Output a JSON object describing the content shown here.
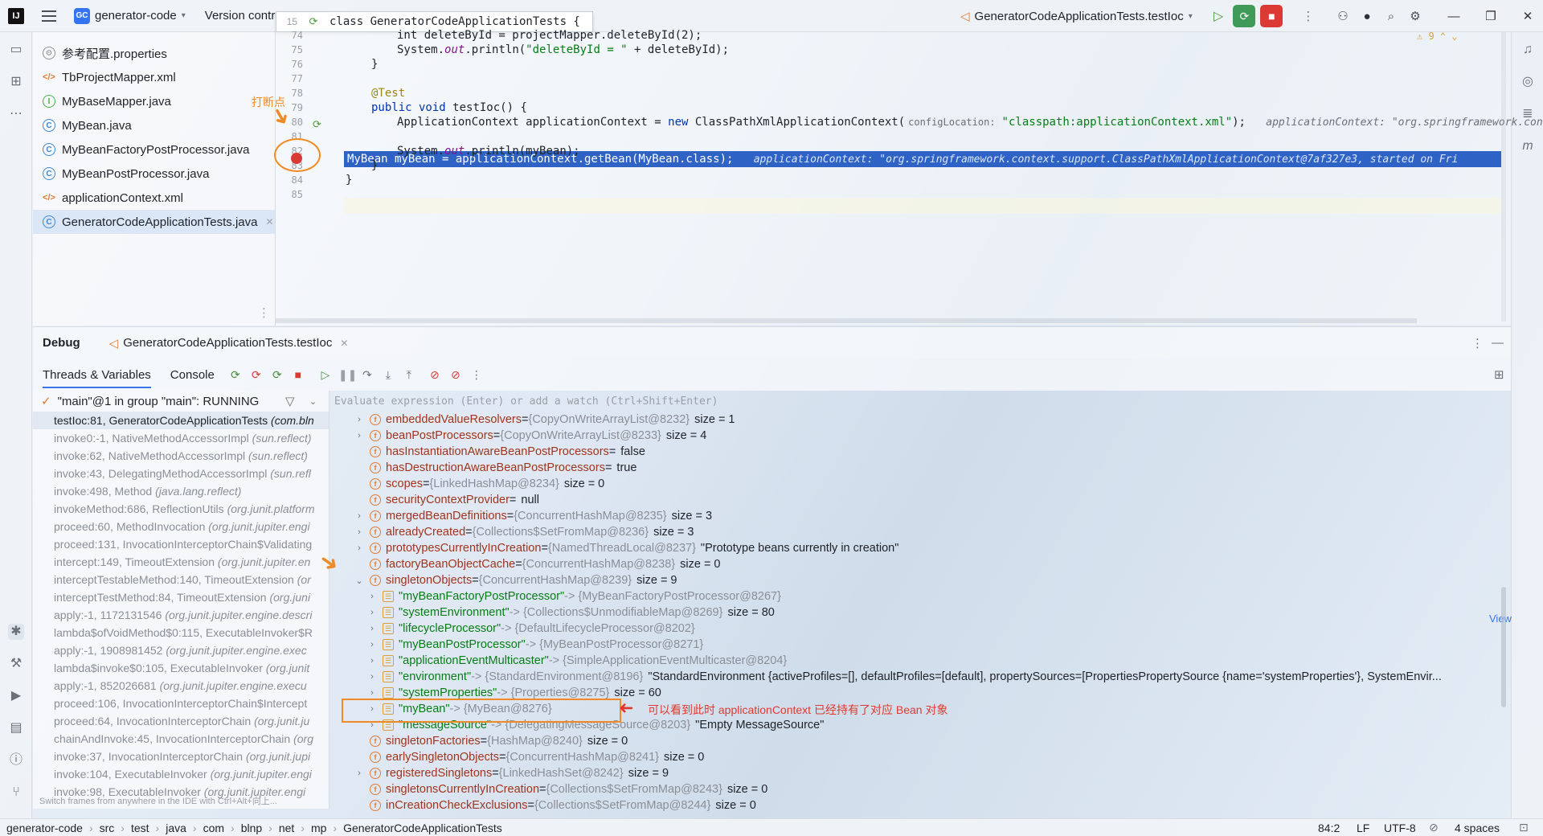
{
  "titlebar": {
    "project_badge": "GC",
    "project_name": "generator-code",
    "version_control": "Version contro",
    "popup_line": "15",
    "popup_code": "class GeneratorCodeApplicationTests {",
    "run_config": "GeneratorCodeApplicationTests.testIoc",
    "warnings": "9"
  },
  "project_tree": [
    {
      "icon": "props",
      "label": "参考配置.properties"
    },
    {
      "icon": "xml",
      "label": "TbProjectMapper.xml"
    },
    {
      "icon": "iface",
      "label": "MyBaseMapper.java"
    },
    {
      "icon": "cls",
      "label": "MyBean.java"
    },
    {
      "icon": "cls",
      "label": "MyBeanFactoryPostProcessor.java"
    },
    {
      "icon": "cls",
      "label": "MyBeanPostProcessor.java"
    },
    {
      "icon": "xml",
      "label": "applicationContext.xml"
    },
    {
      "icon": "cls",
      "label": "GeneratorCodeApplicationTests.java"
    }
  ],
  "editor": {
    "line_numbers": [
      "74",
      "75",
      "76",
      "77",
      "78",
      "79",
      "80",
      "81",
      "82",
      "83",
      "84",
      "85"
    ],
    "breakpoint_label": "打断点",
    "l74": "int deleteById = projectMapper.deleteById(2);",
    "l75_a": "System.",
    "l75_b": "out",
    "l75_c": ".println(",
    "l75_d": "\"deleteById = \"",
    "l75_e": " + deleteById);",
    "l76": "}",
    "l78": "@Test",
    "l79_kw": "public void ",
    "l79_rest": "testIoc() {",
    "l80_a": "ApplicationContext applicationContext = ",
    "l80_kw": "new ",
    "l80_b": "ClassPathXmlApplicationContext(",
    "l80_hint": "configLocation:",
    "l80_str": "\"classpath:applicationContext.xml\"",
    "l80_end": ");",
    "l80_inline": "applicationContext: \"org.springframework.contex",
    "l81": "MyBean myBean = applicationContext.getBean(MyBean.class);",
    "l81_inline": "applicationContext: \"org.springframework.context.support.ClassPathXmlApplicationContext@7af327e3, started on Fri",
    "l82_a": "System.",
    "l82_b": "out",
    "l82_c": ".println(myBean);",
    "l83": "}",
    "l84": "}"
  },
  "debug": {
    "title": "Debug",
    "session_tab": "GeneratorCodeApplicationTests.testIoc",
    "tab_threads": "Threads & Variables",
    "tab_console": "Console",
    "thread": "\"main\"@1 in group \"main\": RUNNING",
    "eval_placeholder": "Evaluate expression (Enter) or add a watch (Ctrl+Shift+Enter)",
    "frames_tip": "Switch frames from anywhere in the IDE with Ctrl+Alt+向上...",
    "frames": [
      {
        "m": "testIoc:81, GeneratorCodeApplicationTests",
        "p": "(com.bln"
      },
      {
        "m": "invoke0:-1, NativeMethodAccessorImpl",
        "p": "(sun.reflect)"
      },
      {
        "m": "invoke:62, NativeMethodAccessorImpl",
        "p": "(sun.reflect)"
      },
      {
        "m": "invoke:43, DelegatingMethodAccessorImpl",
        "p": "(sun.refl"
      },
      {
        "m": "invoke:498, Method",
        "p": "(java.lang.reflect)"
      },
      {
        "m": "invokeMethod:686, ReflectionUtils",
        "p": "(org.junit.platform"
      },
      {
        "m": "proceed:60, MethodInvocation",
        "p": "(org.junit.jupiter.engi"
      },
      {
        "m": "proceed:131, InvocationInterceptorChain$Validating",
        "p": ""
      },
      {
        "m": "intercept:149, TimeoutExtension",
        "p": "(org.junit.jupiter.en"
      },
      {
        "m": "interceptTestableMethod:140, TimeoutExtension",
        "p": "(or"
      },
      {
        "m": "interceptTestMethod:84, TimeoutExtension",
        "p": "(org.juni"
      },
      {
        "m": "apply:-1, 1172131546",
        "p": "(org.junit.jupiter.engine.descri"
      },
      {
        "m": "lambda$ofVoidMethod$0:115, ExecutableInvoker$R",
        "p": ""
      },
      {
        "m": "apply:-1, 1908981452",
        "p": "(org.junit.jupiter.engine.exec"
      },
      {
        "m": "lambda$invoke$0:105, ExecutableInvoker",
        "p": "(org.junit"
      },
      {
        "m": "apply:-1, 852026681",
        "p": "(org.junit.jupiter.engine.execu"
      },
      {
        "m": "proceed:106, InvocationInterceptorChain$Intercept",
        "p": ""
      },
      {
        "m": "proceed:64, InvocationInterceptorChain",
        "p": "(org.junit.ju"
      },
      {
        "m": "chainAndInvoke:45, InvocationInterceptorChain",
        "p": "(org"
      },
      {
        "m": "invoke:37, InvocationInterceptorChain",
        "p": "(org.junit.jupi"
      },
      {
        "m": "invoke:104, ExecutableInvoker",
        "p": "(org.junit.jupiter.engi"
      },
      {
        "m": "invoke:98, ExecutableInvoker",
        "p": "(org.junit.jupiter.engi"
      }
    ],
    "variables": [
      {
        "d": 0,
        "c": "›",
        "i": "f",
        "n": "embeddedValueResolvers",
        "m": "{CopyOnWriteArrayList@8232}",
        "v": "size = 1"
      },
      {
        "d": 0,
        "c": "›",
        "i": "f",
        "n": "beanPostProcessors",
        "m": "{CopyOnWriteArrayList@8233}",
        "v": "size = 4"
      },
      {
        "d": 0,
        "c": "",
        "i": "f",
        "n": "hasInstantiationAwareBeanPostProcessors",
        "m": "",
        "v": "false"
      },
      {
        "d": 0,
        "c": "",
        "i": "f",
        "n": "hasDestructionAwareBeanPostProcessors",
        "m": "",
        "v": "true"
      },
      {
        "d": 0,
        "c": "",
        "i": "f",
        "n": "scopes",
        "m": "{LinkedHashMap@8234}",
        "v": "size = 0"
      },
      {
        "d": 0,
        "c": "",
        "i": "f",
        "n": "securityContextProvider",
        "m": "",
        "v": "null"
      },
      {
        "d": 0,
        "c": "›",
        "i": "f",
        "n": "mergedBeanDefinitions",
        "m": "{ConcurrentHashMap@8235}",
        "v": "size = 3"
      },
      {
        "d": 0,
        "c": "›",
        "i": "f",
        "n": "alreadyCreated",
        "m": "{Collections$SetFromMap@8236}",
        "v": "size = 3"
      },
      {
        "d": 0,
        "c": "›",
        "i": "f",
        "n": "prototypesCurrentlyInCreation",
        "m": "{NamedThreadLocal@8237}",
        "v": "\"Prototype beans currently in creation\""
      },
      {
        "d": 0,
        "c": "",
        "i": "f",
        "n": "factoryBeanObjectCache",
        "m": "{ConcurrentHashMap@8238}",
        "v": "size = 0"
      },
      {
        "d": 0,
        "c": "⌄",
        "i": "f",
        "n": "singletonObjects",
        "m": "{ConcurrentHashMap@8239}",
        "v": "size = 9"
      },
      {
        "d": 1,
        "c": "›",
        "i": "map",
        "n": "\"myBeanFactoryPostProcessor\"",
        "m": "-> {MyBeanFactoryPostProcessor@8267}",
        "v": ""
      },
      {
        "d": 1,
        "c": "›",
        "i": "map",
        "n": "\"systemEnvironment\"",
        "m": "-> {Collections$UnmodifiableMap@8269}",
        "v": "size = 80"
      },
      {
        "d": 1,
        "c": "›",
        "i": "map",
        "n": "\"lifecycleProcessor\"",
        "m": "-> {DefaultLifecycleProcessor@8202}",
        "v": ""
      },
      {
        "d": 1,
        "c": "›",
        "i": "map",
        "n": "\"myBeanPostProcessor\"",
        "m": "-> {MyBeanPostProcessor@8271}",
        "v": ""
      },
      {
        "d": 1,
        "c": "›",
        "i": "map",
        "n": "\"applicationEventMulticaster\"",
        "m": "-> {SimpleApplicationEventMulticaster@8204}",
        "v": ""
      },
      {
        "d": 1,
        "c": "›",
        "i": "map",
        "n": "\"environment\"",
        "m": "-> {StandardEnvironment@8196}",
        "v": "\"StandardEnvironment {activeProfiles=[], defaultProfiles=[default], propertySources=[PropertiesPropertySource {name='systemProperties'}, SystemEnvir..."
      },
      {
        "d": 1,
        "c": "›",
        "i": "map",
        "n": "\"systemProperties\"",
        "m": "-> {Properties@8275}",
        "v": "size = 60"
      },
      {
        "d": 1,
        "c": "›",
        "i": "map",
        "n": "\"myBean\"",
        "m": "-> {MyBean@8276}",
        "v": ""
      },
      {
        "d": 1,
        "c": "›",
        "i": "map",
        "n": "\"messageSource\"",
        "m": "-> {DelegatingMessageSource@8203}",
        "v": "\"Empty MessageSource\""
      },
      {
        "d": 0,
        "c": "",
        "i": "f",
        "n": "singletonFactories",
        "m": "{HashMap@8240}",
        "v": "size = 0"
      },
      {
        "d": 0,
        "c": "",
        "i": "f",
        "n": "earlySingletonObjects",
        "m": "{ConcurrentHashMap@8241}",
        "v": "size = 0"
      },
      {
        "d": 0,
        "c": "›",
        "i": "f",
        "n": "registeredSingletons",
        "m": "{LinkedHashSet@8242}",
        "v": "size = 9"
      },
      {
        "d": 0,
        "c": "",
        "i": "f",
        "n": "singletonsCurrentlyInCreation",
        "m": "{Collections$SetFromMap@8243}",
        "v": "size = 0"
      },
      {
        "d": 0,
        "c": "",
        "i": "f",
        "n": "inCreationCheckExclusions",
        "m": "{Collections$SetFromMap@8244}",
        "v": "size = 0"
      }
    ],
    "view_link": "View",
    "annotation": "可以看到此时 applicationContext 已经持有了对应 Bean 对象"
  },
  "statusbar": {
    "crumbs": [
      "generator-code",
      "src",
      "test",
      "java",
      "com",
      "blnp",
      "net",
      "mp",
      "GeneratorCodeApplicationTests"
    ],
    "position": "84:2",
    "line_sep": "LF",
    "encoding": "UTF-8",
    "indent": "4 spaces"
  }
}
